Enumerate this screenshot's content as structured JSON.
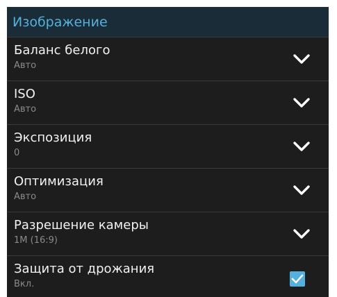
{
  "section": {
    "title": "Изображение"
  },
  "settings": [
    {
      "title": "Баланс белого",
      "value": "Авто",
      "control": "dropdown"
    },
    {
      "title": "ISO",
      "value": "Авто",
      "control": "dropdown"
    },
    {
      "title": "Экспозиция",
      "value": "0",
      "control": "dropdown"
    },
    {
      "title": "Оптимизация",
      "value": "Авто",
      "control": "dropdown"
    },
    {
      "title": "Разрешение камеры",
      "value": "1M (16:9)",
      "control": "dropdown"
    },
    {
      "title": "Защита от дрожания",
      "value": "Вкл.",
      "control": "checkbox",
      "checked": true
    }
  ],
  "colors": {
    "accent": "#55b1db",
    "panel": "#1d1d1d",
    "header": "#1a2c38",
    "divider": "#3a3a3a"
  },
  "icons": {
    "dropdown": "chevron-down-icon",
    "checkbox": "checkmark-icon"
  }
}
